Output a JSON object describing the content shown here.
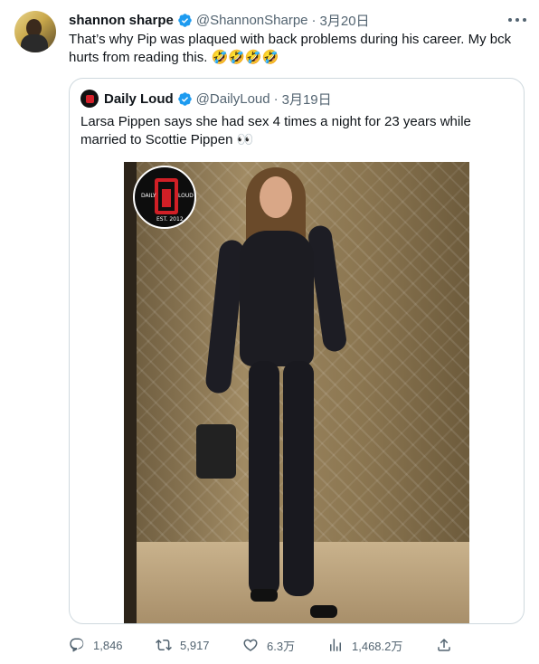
{
  "author": {
    "name": "shannon sharpe",
    "handle": "@ShannonSharpe",
    "separator": "·",
    "date": "3月20日"
  },
  "tweet_text": "That’s why Pip was plaqued with back problems during his career. My bck hurts from reading this. 🤣🤣🤣🤣",
  "quote": {
    "name": "Daily Loud",
    "handle": "@DailyLoud",
    "separator": "·",
    "date": "3月19日",
    "text": "Larsa Pippen says she had sex 4 times a night for 23 years while married to Scottie Pippen 👀",
    "media_logo": {
      "left_text": "DAILY",
      "right_text": "LOUD",
      "bottom_text": "EST. 2012"
    }
  },
  "actions": {
    "replies": "1,846",
    "retweets": "5,917",
    "likes": "6.3万",
    "views": "1,468.2万"
  },
  "colors": {
    "text": "#0f1419",
    "secondary": "#536471",
    "border": "#cfd9de",
    "verified": "#1d9bf0"
  }
}
